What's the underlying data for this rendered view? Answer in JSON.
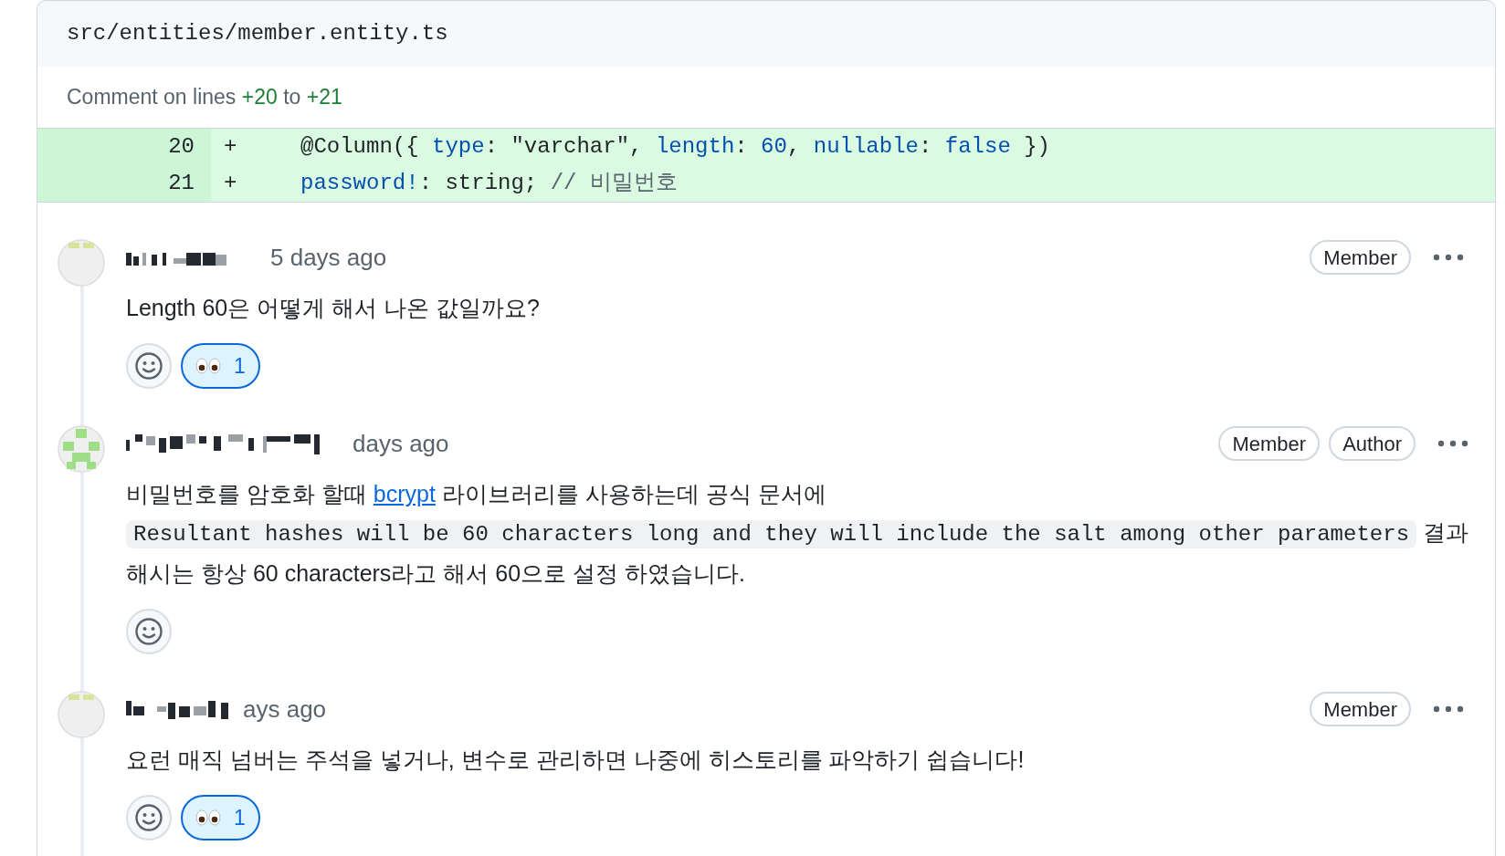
{
  "file": {
    "path": "src/entities/member.entity.ts",
    "comment_range": {
      "prefix": "Comment on lines",
      "start": "+20",
      "middle": "to",
      "end": "+21"
    }
  },
  "diff": [
    {
      "number": "20",
      "sign": "+",
      "tokens": [
        {
          "text": "@Column({ ",
          "kind": "plain"
        },
        {
          "text": "type",
          "kind": "key"
        },
        {
          "text": ": \"varchar\", ",
          "kind": "plain"
        },
        {
          "text": "length",
          "kind": "key"
        },
        {
          "text": ": ",
          "kind": "plain"
        },
        {
          "text": "60",
          "kind": "key"
        },
        {
          "text": ", ",
          "kind": "plain"
        },
        {
          "text": "nullable",
          "kind": "key"
        },
        {
          "text": ": ",
          "kind": "plain"
        },
        {
          "text": "false",
          "kind": "key"
        },
        {
          "text": " })",
          "kind": "plain"
        }
      ]
    },
    {
      "number": "21",
      "sign": "+",
      "tokens": [
        {
          "text": "password!",
          "kind": "key"
        },
        {
          "text": ": string; ",
          "kind": "plain"
        },
        {
          "text": "// 비밀번호",
          "kind": "comment"
        }
      ]
    }
  ],
  "comments": [
    {
      "time": "5 days ago",
      "badges": [
        "Member"
      ],
      "body": [
        [
          {
            "kind": "text",
            "text": "Length 60은 어떻게 해서 나온 값일까요?"
          }
        ]
      ],
      "reactions": [
        {
          "kind": "add"
        },
        {
          "kind": "eyes",
          "count": "1",
          "selected": true
        }
      ]
    },
    {
      "time": "days ago",
      "badges": [
        "Member",
        "Author"
      ],
      "body": [
        [
          {
            "kind": "text",
            "text": "비밀번호를 암호화 할때 "
          },
          {
            "kind": "link",
            "text": "bcrypt"
          },
          {
            "kind": "text",
            "text": " 라이브러리를 사용하는데 공식 문서에"
          }
        ],
        [
          {
            "kind": "code",
            "text": "Resultant hashes will be 60 characters long and they will include the salt among other parameters"
          },
          {
            "kind": "text",
            "text": " 결과"
          }
        ],
        [
          {
            "kind": "text",
            "text": "해시는 항상 60 characters라고 해서 60으로 설정 하였습니다."
          }
        ]
      ],
      "reactions": [
        {
          "kind": "add"
        }
      ]
    },
    {
      "time": "ays ago",
      "badges": [
        "Member"
      ],
      "body": [
        [
          {
            "kind": "text",
            "text": "요런 매직 넘버는 주석을 넣거나, 변수로 관리하면 나중에 히스토리를 파악하기 쉽습니다!"
          }
        ]
      ],
      "reactions": [
        {
          "kind": "add"
        },
        {
          "kind": "eyes",
          "count": "1",
          "selected": true
        }
      ]
    }
  ]
}
